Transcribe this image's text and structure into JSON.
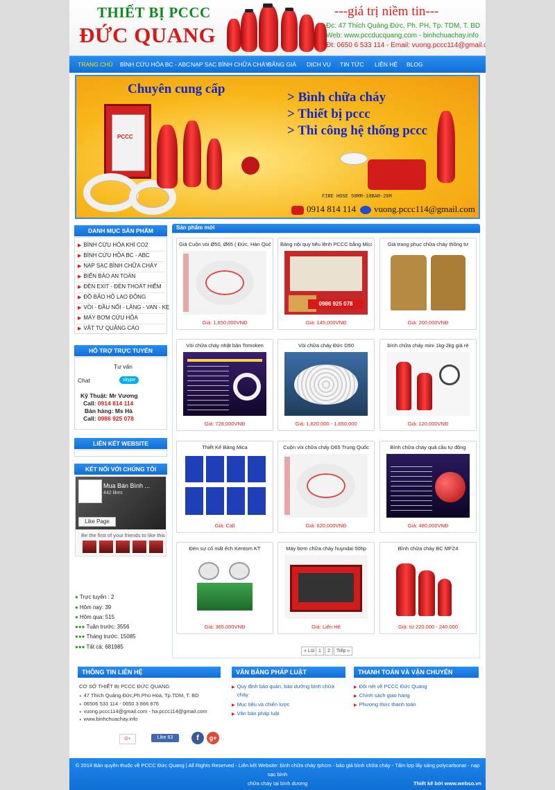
{
  "header": {
    "logo_top": "THIẾT BỊ PCCC",
    "logo_main": "ĐỨC QUANG",
    "slogan": "---giá trị niềm tin---",
    "address": "Đc: 47 Thích Quảng Đức, Ph. PH, Tp. TDM, T. BD",
    "web": "Web: www.pccducquang.com - binhchuachay.info",
    "contact": "Đt: 0650 6 533 114 - Email: vuong.pccc114@gmail.com"
  },
  "nav": [
    "TRANG CHỦ",
    "BÌNH CỨU HỎA BC - ABC",
    "NẠP SẠC BÌNH CHỮA CHÁY",
    "BẢNG GIÁ",
    "DỊCH VỤ",
    "TIN TỨC",
    "LIÊN HỆ",
    "BLOG"
  ],
  "banner": {
    "heading": "Chuyên cung cấp",
    "lines": [
      "> Bình chữa cháy",
      "> Thiết bị pccc",
      "> Thi công hệ thống pccc"
    ],
    "cabinet_label": "PCCC",
    "hose_text": "FIRE HOSE 50MM-10BAR-20M",
    "phone": "0914 814 114",
    "email": "vuong.pccc114@gmail.com"
  },
  "categories": {
    "title": "DANH MỤC SẢN PHẨM",
    "items": [
      "BÌNH CỨU HỎA KHÍ CO2",
      "BÌNH CỨU HỎA BC - ABC",
      "NẠP SẠC BÌNH CHỮA CHÁY",
      "BIỂN BÁO AN TOÀN",
      "ĐÈN EXIT - ĐÈN THOÁT HIỂM",
      "ĐỒ BẢO HỘ LAO ĐỘNG",
      "VÒI - ĐẦU NỐI - LĂNG - VAN - KẸ",
      "MÁY BƠM CỨU HỎA",
      "VẬT TƯ QUẢNG CÁO"
    ]
  },
  "support": {
    "title": "HỖ TRỢ TRỰC TUYẾN",
    "consult": "Tư vấn",
    "chat": "Chat",
    "skype": "skype",
    "tech_label": "Kỹ Thuật:  Mr Vương",
    "tech_call_label": "Call:",
    "tech_phone": "0914 814 114",
    "sales_label": "Bán hàng: Ms Hà",
    "sales_call_label": "Call:",
    "sales_phone": "0986 925 078"
  },
  "links_title": "LIÊN KẾT WEBSITE",
  "connect": {
    "title": "KẾT NỐI VỚI CHÚNG TÔI",
    "page_name": "Mua Bán Bình ...",
    "likes": "442 likes",
    "like_page": "Like Page",
    "friends": "Be the first of your friends to like this"
  },
  "stats": [
    {
      "label": "Trực tuyến :",
      "value": "2"
    },
    {
      "label": "Hôm nay:",
      "value": "39"
    },
    {
      "label": "Hôm qua:",
      "value": "515"
    },
    {
      "label": "Tuần trước:",
      "value": "3556"
    },
    {
      "label": "Tháng trước:",
      "value": "15085"
    },
    {
      "label": "Tất cả:",
      "value": "681985"
    }
  ],
  "products": {
    "title": "Sản phẩm mới",
    "items": [
      {
        "name": "Giá Cuộn vòi Ø50, Ø65 ( Đức, Hàn Quốc,",
        "price": "Giá: 1,650,000VNĐ",
        "img": "hose"
      },
      {
        "name": "Bảng nội quy tiêu lệnh PCCC bằng Mica",
        "price": "Giá: 145,000VNĐ",
        "img": "board",
        "badge": "0986 925 078"
      },
      {
        "name": "Giá trang phục chữa cháy thông tư",
        "price": "Giá: 200,000VNĐ",
        "img": "suit"
      },
      {
        "name": "Vòi chữa cháy nhật bản Tomoken",
        "price": "Giá: 728,000VNĐ",
        "img": "spec"
      },
      {
        "name": "Vòi chữa cháy Đức D50",
        "price": "Giá: 1,620,000 - 1,650,000",
        "img": "hose2"
      },
      {
        "name": "bình chữa cháy mini 1kg-2kg giá rẻ",
        "price": "Giá: 120,000VNĐ",
        "img": "mini"
      },
      {
        "name": "Thiết Kế Bảng Mica",
        "price": "Giá: Call",
        "img": "signs"
      },
      {
        "name": "Cuộn vòi chữa cháy D65 Trung Quốc",
        "price": "Giá: 620,000VNĐ",
        "img": "hose"
      },
      {
        "name": "Bình chữa cháy quả cầu tự động",
        "price": "Giá: 480,000VNĐ",
        "img": "ball"
      },
      {
        "name": "Đèn sự cố mất ếch Kentom KT",
        "price": "Giá: 365,000VNĐ",
        "img": "lamp"
      },
      {
        "name": "Máy bơm chữa cháy huyndai 50hp",
        "price": "Giá: Liên Hệ",
        "img": "pump"
      },
      {
        "name": "Bình chữa cháy BC MFZ4",
        "price": "Giá: từ 220.000 - 240.000",
        "img": "ext"
      }
    ]
  },
  "pager": {
    "prev": "« Lùi",
    "p1": "1",
    "p2": "2",
    "next": "Tiếp »"
  },
  "footer": {
    "contact_title": "THÔNG TIN LIÊN HỆ",
    "company": "CƠ SỞ THIẾT BỊ PCCC ĐỨC QUANG",
    "address": "47 Thích Quảng Đức,Ph.Phú Hòa, Tp.TDM, T. BD",
    "phones": "06506 533 114 - 0650 3 866 876",
    "emails": "vuong.pccc114@gmail.com   - ha.pccc114@gmail.com",
    "website": "www.binhchuachay.info",
    "law_title": "VĂN BẢNG PHÁP LUẬT",
    "law_items": [
      "Quy định bảo quản, bảo dưỡng bình chữa",
      "cháy",
      "Mục tiêu và chiến lược",
      "Văn bản pháp luật"
    ],
    "pay_title": "THANH TOÁN VÀ VẬN CHUYỂN",
    "pay_items": [
      "Đôi nét về PCCC Đức Quang",
      "Chính sách giao hàng",
      "Phương thức thanh toán"
    ],
    "gplus": "G+",
    "like": "Like 63",
    "fb": "f",
    "g": "g+",
    "copy1": "© 2014 Bản quyền thuộc về PCCC Đức Quang  | All Rights Reserved - Liên kết Website: bình chữa cháy tphcm - báo giá bình chữa cháy - Tấm lợp lấy sáng polycarbonat - nạp sạc bình",
    "copy2": "chữa cháy tại bình dương",
    "design": "Thiết kế bởi www.webso.vn"
  },
  "colors": {
    "accent": "#0f6fd6",
    "red": "#d51a1a",
    "green": "#0b8a1e"
  }
}
